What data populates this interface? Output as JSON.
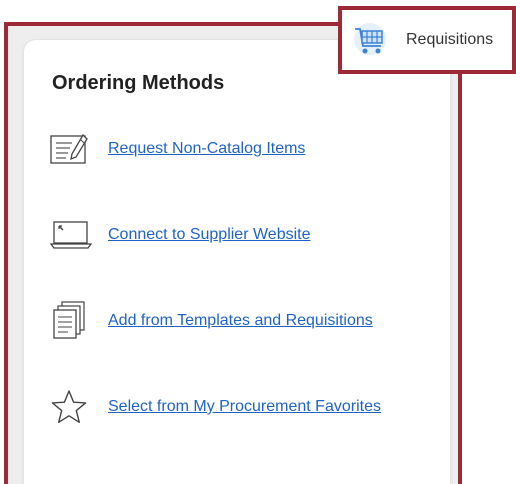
{
  "panel": {
    "title": "Ordering Methods",
    "methods": [
      {
        "label": "Request Non-Catalog Items",
        "icon": "form-edit-icon"
      },
      {
        "label": "Connect to Supplier Website",
        "icon": "laptop-icon"
      },
      {
        "label": "Add from Templates and Requisitions",
        "icon": "documents-stack-icon"
      },
      {
        "label": "Select from My Procurement Favorites",
        "icon": "star-icon"
      }
    ]
  },
  "requisitions": {
    "label": "Requisitions",
    "icon": "shopping-cart-icon"
  },
  "colors": {
    "highlight": "#9e2a38",
    "link": "#1f63c6",
    "cart": "#5aa0e6"
  }
}
